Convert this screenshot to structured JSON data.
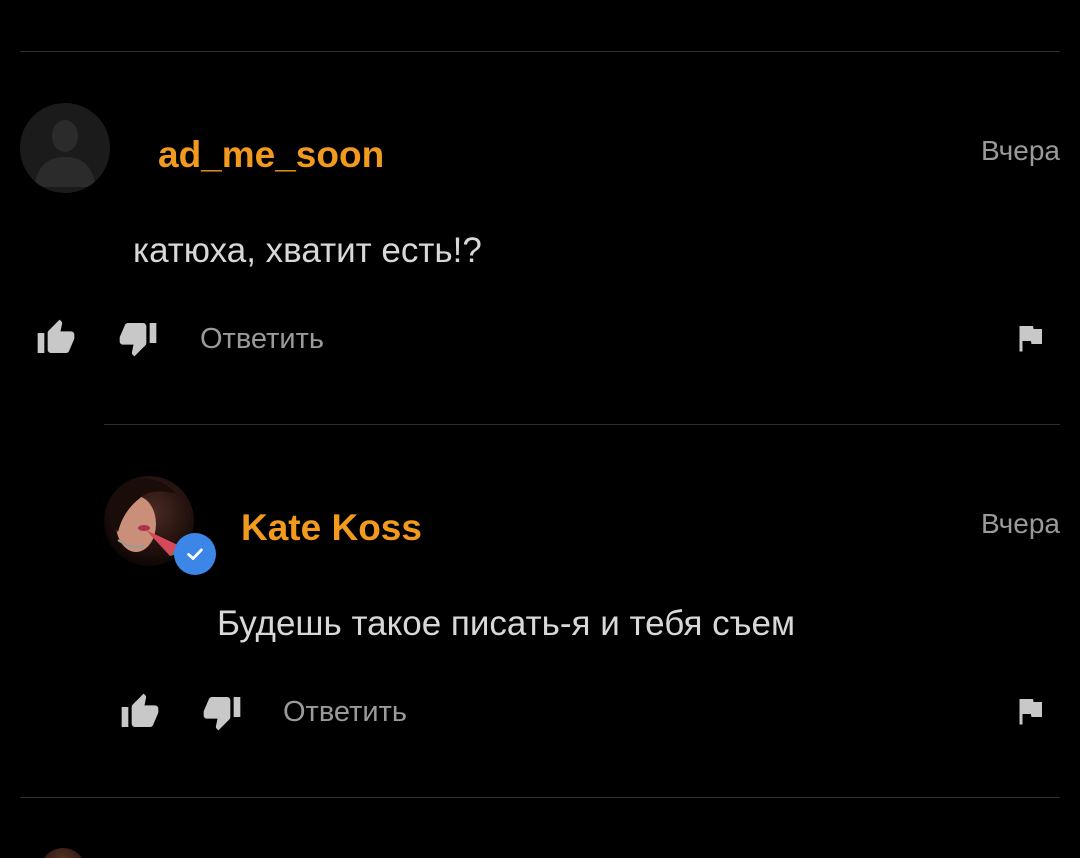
{
  "comments": [
    {
      "username": "ad_me_soon",
      "date": "Вчера",
      "text": "катюха, хватит есть!?",
      "reply_label": "Ответить"
    },
    {
      "username": "Kate Koss",
      "date": "Вчера",
      "text": "Будешь такое писать-я и тебя съем",
      "reply_label": "Ответить",
      "verified": true
    }
  ],
  "colors": {
    "username": "#f29a1d",
    "text": "#d8d8d8",
    "meta": "#9a9a9a",
    "verified_badge": "#3b86e6",
    "background": "#000000"
  }
}
